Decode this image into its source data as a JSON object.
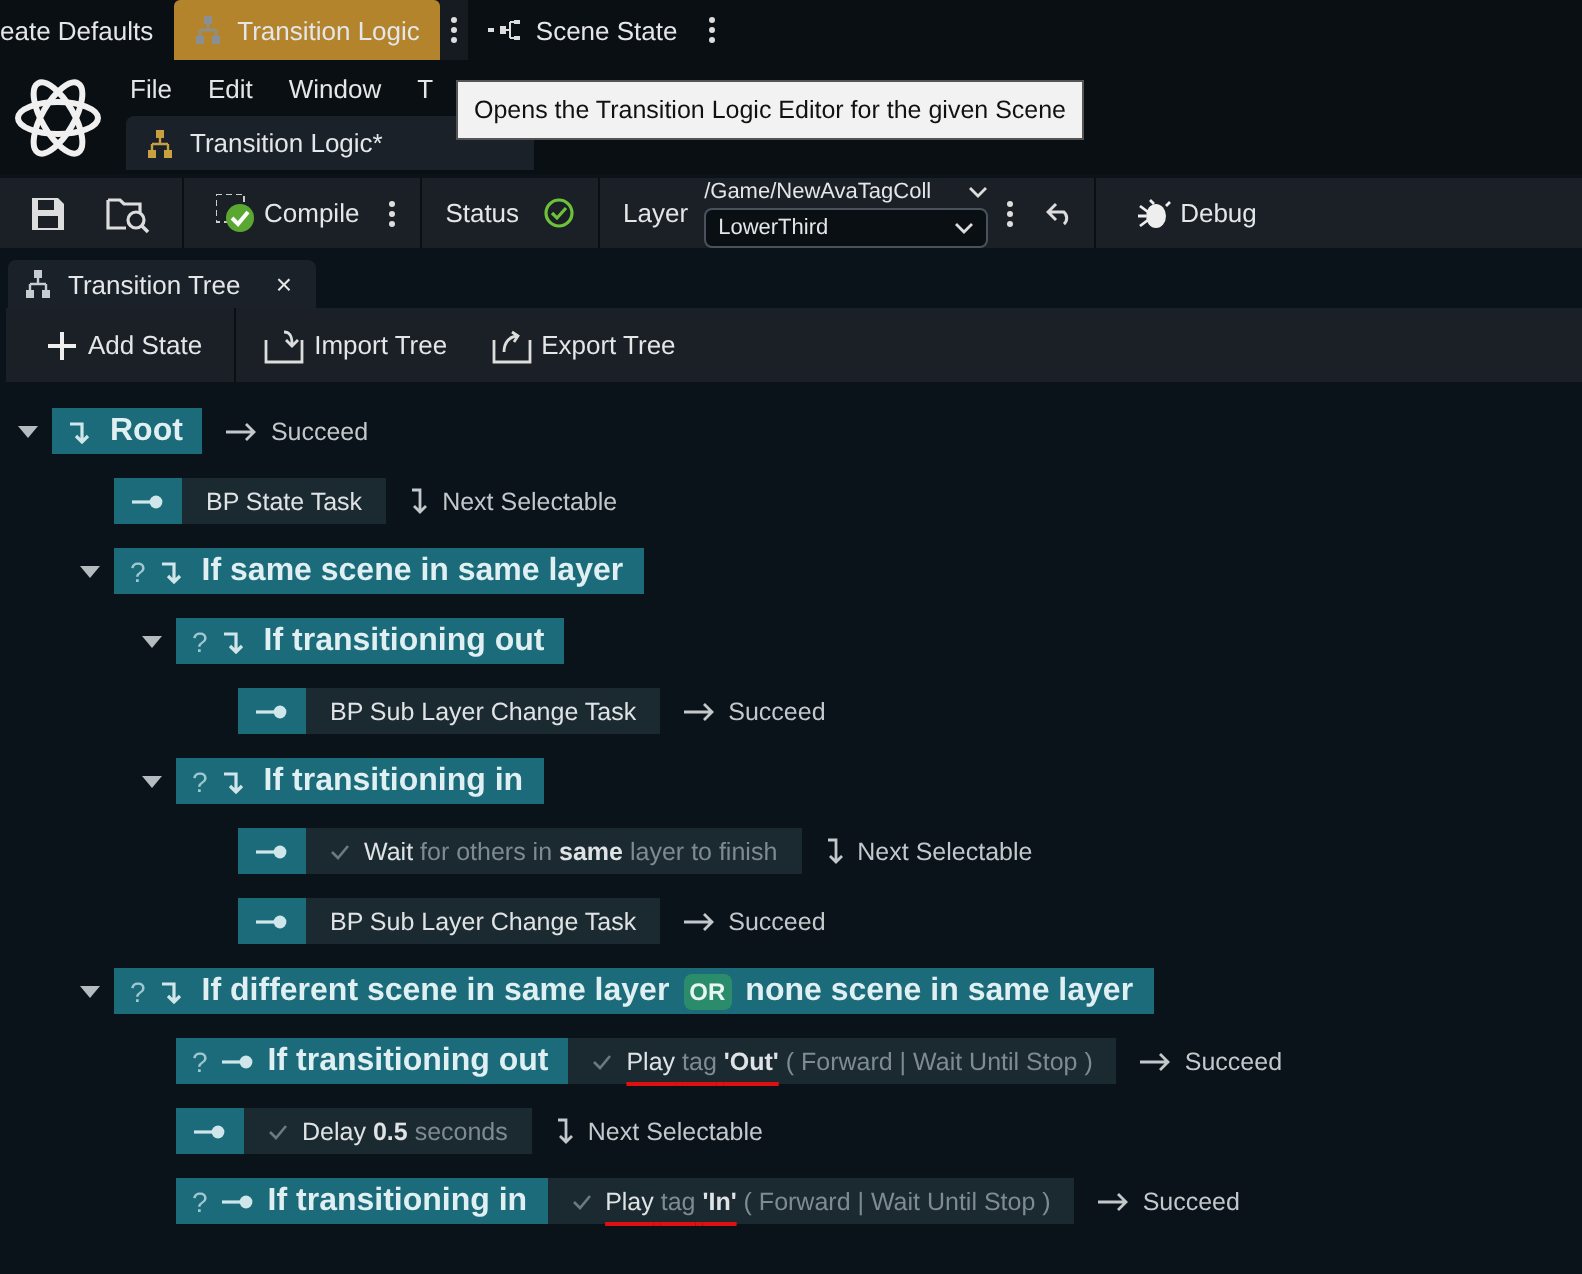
{
  "top_tabs": [
    {
      "label": "eate Defaults",
      "selected": false,
      "menu": false
    },
    {
      "label": "Transition Logic",
      "selected": true,
      "menu": true
    },
    {
      "label": "Scene State",
      "selected": false,
      "menu": true
    }
  ],
  "menu": [
    "File",
    "Edit",
    "Window",
    "T"
  ],
  "document_tab": {
    "label": "Transition Logic*"
  },
  "tooltip": "Opens the Transition Logic Editor for the given Scene",
  "toolbar": {
    "compile": "Compile",
    "status_label": "Status",
    "status_ok": true,
    "layer_label": "Layer",
    "layer_path": "/Game/NewAvaTagColl",
    "layer_value": "LowerThird",
    "debug": "Debug"
  },
  "panel_tab": {
    "label": "Transition Tree",
    "close": "×"
  },
  "tree_toolbar": [
    {
      "label": "Add State",
      "kind": "add"
    },
    {
      "label": "Import Tree",
      "kind": "import"
    },
    {
      "label": "Export Tree",
      "kind": "export"
    }
  ],
  "tree": {
    "kind": "state",
    "title": [
      {
        "text": "Root",
        "kind": "text"
      }
    ],
    "expanded": true,
    "transition": {
      "kind": "succeed",
      "label": "Succeed"
    },
    "children": [
      {
        "kind": "task",
        "checked": false,
        "text": [
          {
            "text": "BP State Task",
            "kind": "value"
          }
        ],
        "transition": {
          "kind": "next",
          "label": "Next Selectable"
        }
      },
      {
        "kind": "state",
        "condition_mark": "?",
        "title": [
          {
            "text": "If same scene in same layer",
            "kind": "text"
          }
        ],
        "expanded": true,
        "children": [
          {
            "kind": "state",
            "condition_mark": "?",
            "title": [
              {
                "text": "If transitioning out",
                "kind": "text"
              }
            ],
            "expanded": true,
            "children": [
              {
                "kind": "task",
                "checked": false,
                "text": [
                  {
                    "text": "BP Sub Layer Change Task",
                    "kind": "value"
                  }
                ],
                "transition": {
                  "kind": "succeed",
                  "label": "Succeed"
                }
              }
            ]
          },
          {
            "kind": "state",
            "condition_mark": "?",
            "title": [
              {
                "text": "If transitioning in",
                "kind": "text"
              }
            ],
            "expanded": true,
            "children": [
              {
                "kind": "task",
                "checked": true,
                "text": [
                  {
                    "text": "Wait",
                    "kind": "value"
                  },
                  {
                    "text": "for others in",
                    "kind": "dim"
                  },
                  {
                    "text": "same",
                    "kind": "bold"
                  },
                  {
                    "text": "layer to finish",
                    "kind": "dim"
                  }
                ],
                "transition": {
                  "kind": "next",
                  "label": "Next Selectable"
                }
              },
              {
                "kind": "task",
                "checked": false,
                "text": [
                  {
                    "text": "BP Sub Layer Change Task",
                    "kind": "value"
                  }
                ],
                "transition": {
                  "kind": "succeed",
                  "label": "Succeed"
                }
              }
            ]
          }
        ]
      },
      {
        "kind": "state",
        "condition_mark": "?",
        "title": [
          {
            "text": "If different scene in same layer",
            "kind": "text"
          },
          {
            "text": "OR",
            "kind": "operator"
          },
          {
            "text": "none scene in same layer",
            "kind": "text"
          }
        ],
        "expanded": true,
        "children": [
          {
            "kind": "state",
            "condition_mark": "?",
            "title": [
              {
                "text": "If transitioning out",
                "kind": "text"
              }
            ],
            "task": {
              "checked": true,
              "text": [
                {
                  "text": "Play",
                  "kind": "value",
                  "underlined": true
                },
                {
                  "text": "tag",
                  "kind": "dim",
                  "underlined": true
                },
                {
                  "text": "'Out'",
                  "kind": "bold",
                  "underlined": true
                },
                {
                  "text": "( Forward | Wait Until Stop )",
                  "kind": "dim"
                }
              ]
            },
            "transition": {
              "kind": "succeed",
              "label": "Succeed"
            }
          },
          {
            "kind": "task",
            "checked": true,
            "text": [
              {
                "text": "Delay",
                "kind": "value"
              },
              {
                "text": "0.5",
                "kind": "bold"
              },
              {
                "text": "seconds",
                "kind": "dim"
              }
            ],
            "transition": {
              "kind": "next",
              "label": "Next Selectable"
            }
          },
          {
            "kind": "state",
            "condition_mark": "?",
            "title": [
              {
                "text": "If transitioning in",
                "kind": "text"
              }
            ],
            "task": {
              "checked": true,
              "text": [
                {
                  "text": "Play",
                  "kind": "value",
                  "underlined": true
                },
                {
                  "text": "tag",
                  "kind": "dim",
                  "underlined": true
                },
                {
                  "text": "'In'",
                  "kind": "bold",
                  "underlined": true
                },
                {
                  "text": "( Forward | Wait Until Stop )",
                  "kind": "dim"
                }
              ]
            },
            "transition": {
              "kind": "succeed",
              "label": "Succeed"
            }
          }
        ]
      }
    ]
  }
}
